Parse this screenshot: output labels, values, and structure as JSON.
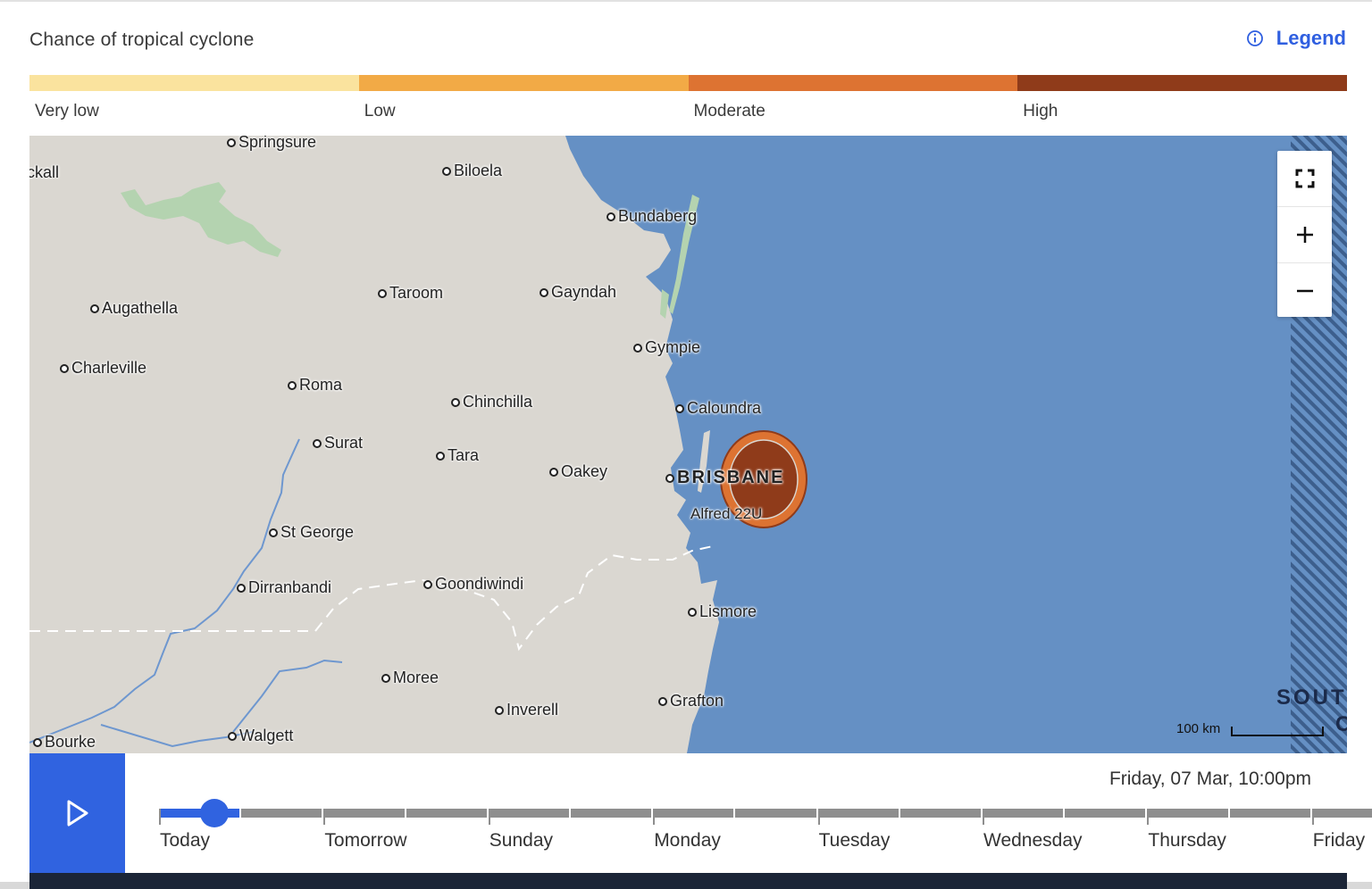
{
  "header": {
    "title": "Chance of tropical cyclone",
    "legend_label": "Legend"
  },
  "scale": {
    "levels": [
      {
        "label": "Very low",
        "color": "#fae39e"
      },
      {
        "label": "Low",
        "color": "#f2aa46"
      },
      {
        "label": "Moderate",
        "color": "#dd7332"
      },
      {
        "label": "High",
        "color": "#8f3b1a"
      }
    ]
  },
  "map": {
    "places": {
      "springsure": "Springsure",
      "tambo": "ckall",
      "biloela": "Biloela",
      "bundaberg": "Bundaberg",
      "taroom": "Taroom",
      "gayndah": "Gayndah",
      "augathella": "Augathella",
      "gympie": "Gympie",
      "charleville": "Charleville",
      "roma": "Roma",
      "chinchilla": "Chinchilla",
      "caloundra": "Caloundra",
      "surat": "Surat",
      "tara": "Tara",
      "oakey": "Oakey",
      "brisbane": "BRISBANE",
      "st_george": "St George",
      "dirranbandi": "Dirranbandi",
      "goondiwindi": "Goondiwindi",
      "lismore": "Lismore",
      "moree": "Moree",
      "inverell": "Inverell",
      "grafton": "Grafton",
      "bourke": "Bourke",
      "walgett": "Walgett"
    },
    "cyclone_label": "Alfred 22U",
    "sea_label_line1": "SOUT",
    "sea_label_line2": "C",
    "scale_label": "100 km",
    "colors": {
      "land": "#dad7d1",
      "ocean": "#6590c4",
      "park": "#b4d3b0",
      "river": "#6e97cf"
    }
  },
  "controls": {
    "fullscreen_icon": "fullscreen-icon",
    "zoom_in_icon": "plus-icon",
    "zoom_out_icon": "minus-icon"
  },
  "timeline": {
    "datetime": "Friday, 07 Mar, 10:00pm",
    "days": [
      "Today",
      "Tomorrow",
      "Sunday",
      "Monday",
      "Tuesday",
      "Wednesday",
      "Thursday",
      "Friday"
    ],
    "step_count": 15,
    "current_step": 0.5,
    "play_icon": "play-icon"
  }
}
